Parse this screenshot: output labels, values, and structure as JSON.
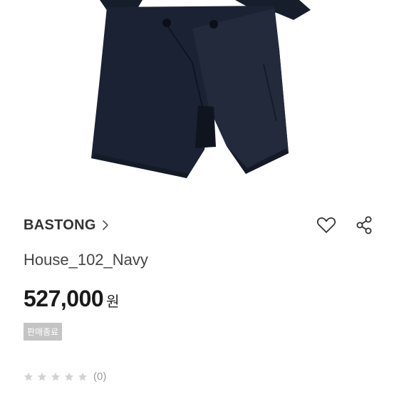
{
  "product": {
    "brand": "BASTONG",
    "name": "House_102_Navy",
    "price": "527,000",
    "currency_unit": "원",
    "status_badge": "판매종료",
    "rating": 0,
    "review_count": "(0)"
  },
  "icons": {
    "brand_chevron": "chevron-right-icon",
    "like": "heart-icon",
    "share": "share-icon",
    "rating": "star-icon"
  },
  "colors": {
    "coat": "#1b2233",
    "badge_bg": "#c4c4c4",
    "star_empty": "#d2d2d2",
    "text_primary": "#1a1a1a"
  }
}
